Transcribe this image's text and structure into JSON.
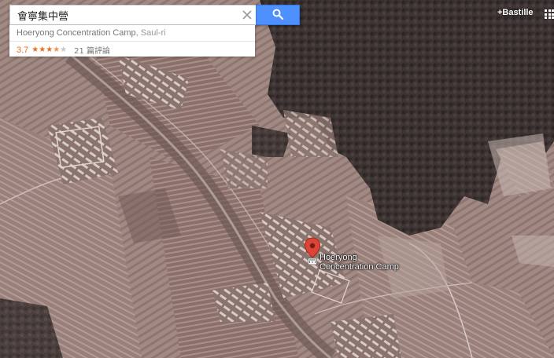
{
  "search": {
    "query": "會寧集中營",
    "button_icon": "search-icon",
    "clear_icon": "close-icon"
  },
  "suggestion": {
    "name": "Hoeryong Concentration Camp",
    "locality": "Saul-ri",
    "rating": "3.7",
    "rating_value": 3.7,
    "reviews": "21 篇評論"
  },
  "header": {
    "user": "+Bastille",
    "apps_icon": "apps-grid-icon"
  },
  "map": {
    "type": "satellite",
    "marker": {
      "icon": "map-pin-icon",
      "badge_icon": "landmark-icon",
      "label_line1": "Hoeryong",
      "label_line2": "Concentration Camp"
    }
  },
  "colors": {
    "search_button": "#4d90fe",
    "star": "#e7711b",
    "marker": "#db4437"
  }
}
